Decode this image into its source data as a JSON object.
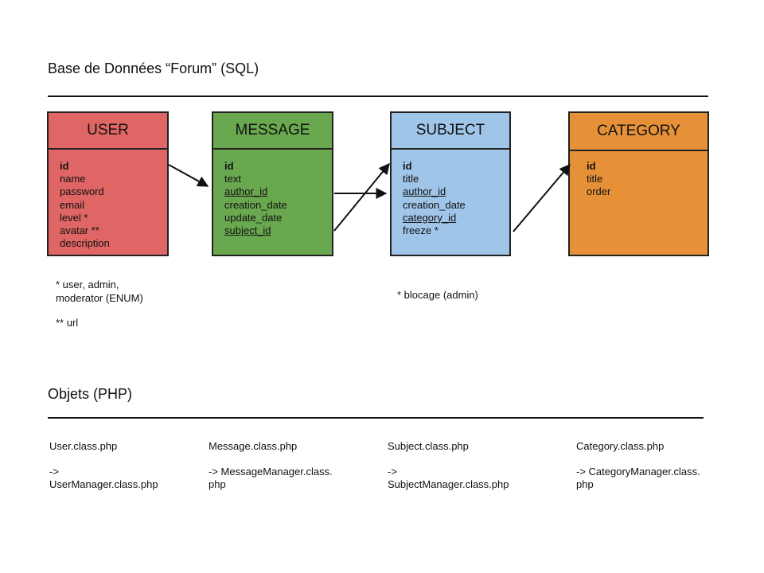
{
  "sql_section": {
    "title": "Base de Données “Forum” (SQL)"
  },
  "tables": {
    "user": {
      "name": "USER",
      "fields": [
        "id",
        "name",
        "password",
        "email",
        "level *",
        "avatar **",
        "description"
      ],
      "color": "#e06666"
    },
    "message": {
      "name": "MESSAGE",
      "fields": [
        "id",
        "text",
        "author_id",
        "creation_date",
        "update_date",
        "subject_id"
      ],
      "color": "#6aa84f"
    },
    "subject": {
      "name": "SUBJECT",
      "fields": [
        "id",
        "title",
        "author_id",
        "creation_date",
        "category_id",
        "freeze *"
      ],
      "color": "#9fc5e8"
    },
    "category": {
      "name": "CATEGORY",
      "fields": [
        "id",
        "title",
        "order"
      ],
      "color": "#e69138"
    }
  },
  "notes": {
    "user_level": [
      "* user, admin,",
      "moderator (ENUM)"
    ],
    "user_avatar": "** url",
    "subject_freeze": "* blocage (admin)"
  },
  "php_section": {
    "title": "Objets (PHP)"
  },
  "objects": {
    "user": {
      "class": "User.class.php",
      "manager": [
        "->",
        "UserManager.class.php"
      ]
    },
    "message": {
      "class": "Message.class.php",
      "manager": [
        "-> MessageManager.class.",
        "php"
      ]
    },
    "subject": {
      "class": "Subject.class.php",
      "manager": [
        "->",
        "SubjectManager.class.php"
      ]
    },
    "category": {
      "class": "Category.class.php",
      "manager": [
        "-> CategoryManager.class.",
        "php"
      ]
    }
  }
}
